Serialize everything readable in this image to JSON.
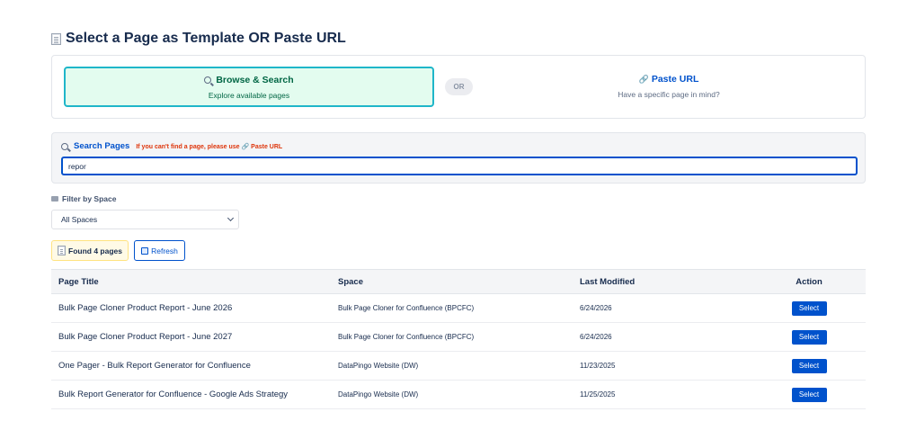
{
  "page": {
    "title": "Select a Page as Template OR Paste URL"
  },
  "modes": {
    "browse": {
      "title": "Browse & Search",
      "subtitle": "Explore available pages"
    },
    "or": "OR",
    "url": {
      "title": "Paste URL",
      "subtitle": "Have a specific page in mind?"
    }
  },
  "search": {
    "label": "Search Pages",
    "hint": "If you can't find a page, please use 🔗 Paste URL",
    "value": "repor"
  },
  "filter": {
    "label": "Filter by Space",
    "selected": "All Spaces"
  },
  "results": {
    "found_label": "Found 4 pages",
    "refresh_label": "Refresh"
  },
  "table": {
    "headers": [
      "Page Title",
      "Space",
      "Last Modified",
      "Action"
    ],
    "rows": [
      {
        "title": "Bulk Page Cloner Product Report - June 2026",
        "space": "Bulk Page Cloner for Confluence (BPCFC)",
        "modified": "6/24/2026",
        "action": "Select"
      },
      {
        "title": "Bulk Page Cloner Product Report - June 2027",
        "space": "Bulk Page Cloner for Confluence (BPCFC)",
        "modified": "6/24/2026",
        "action": "Select"
      },
      {
        "title": "One Pager - Bulk Report Generator for Confluence",
        "space": "DataPingo Website (DW)",
        "modified": "11/23/2025",
        "action": "Select"
      },
      {
        "title": "Bulk Report Generator for Confluence - Google Ads Strategy",
        "space": "DataPingo Website (DW)",
        "modified": "11/25/2025",
        "action": "Select"
      }
    ]
  },
  "colors": {
    "primary": "#0052cc",
    "success_bg": "#e3fcef",
    "success_text": "#006644",
    "active_border": "#1fb6c9",
    "warning_text": "#de350b",
    "found_bg": "#fffae6"
  },
  "icons": {
    "title": "page-icon",
    "browse": "magnifier-icon",
    "url": "link-icon",
    "search": "magnifier-icon",
    "filter": "chat-icon",
    "found": "page-icon",
    "refresh": "refresh-icon"
  }
}
